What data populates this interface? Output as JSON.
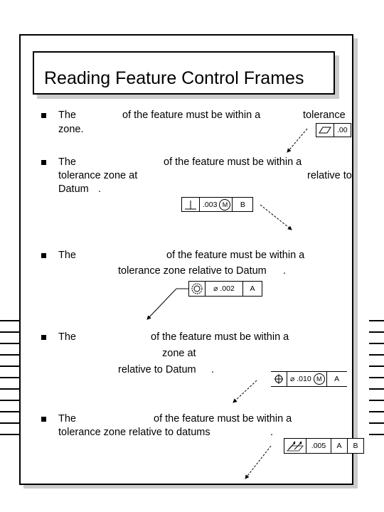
{
  "title": "Reading Feature Control Frames",
  "bullets": [
    {
      "lines": [
        [
          "The",
          "of the feature must be within a",
          "tolerance"
        ],
        [
          "zone."
        ]
      ],
      "frame": {
        "symbol": "flatness-icon",
        "cells": [
          ".00"
        ]
      }
    },
    {
      "lines": [
        [
          "The",
          "of the feature must be within a"
        ],
        [
          "tolerance zone at",
          "relative to"
        ],
        [
          "Datum",
          "."
        ]
      ],
      "frame": {
        "symbol": "perpendicularity-icon",
        "cells": [
          ".003",
          "M",
          "B"
        ]
      }
    },
    {
      "lines": [
        [
          "The",
          "of the feature must be within a"
        ],
        [
          "tolerance zone relative to Datum",
          "."
        ]
      ],
      "frame": {
        "symbol": "concentricity-icon",
        "cells": [
          "⌀ .002",
          "A"
        ]
      }
    },
    {
      "lines": [
        [
          "The",
          "of the feature must be within a"
        ],
        [
          "zone at"
        ],
        [
          "relative to Datum",
          "."
        ]
      ],
      "frame": {
        "symbol": "position-icon",
        "cells": [
          "⌀ .010",
          "M",
          "A"
        ]
      }
    },
    {
      "lines": [
        [
          "The",
          "of the feature must be within a"
        ],
        [
          "tolerance zone relative to datums",
          "."
        ]
      ],
      "frame": {
        "symbol": "total-runout-icon",
        "cells": [
          ".005",
          "A",
          "B"
        ]
      }
    }
  ]
}
